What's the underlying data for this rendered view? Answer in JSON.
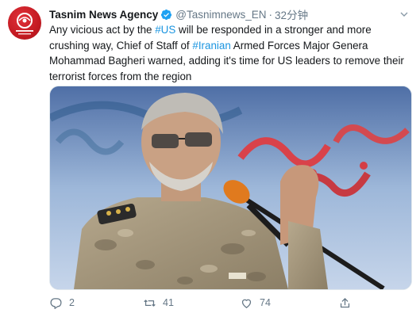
{
  "tweet": {
    "author_name": "Tasnim News Agency",
    "handle": "@Tasnimnews_EN",
    "separator": "·",
    "time": "32分钟",
    "verified": true,
    "text_parts": [
      {
        "text": "Any vicious act by the ",
        "type": "plain"
      },
      {
        "text": "#US",
        "type": "hashtag"
      },
      {
        "text": " will be responded in a stronger and more crushing way, Chief of Staff of ",
        "type": "plain"
      },
      {
        "text": "#Iranian",
        "type": "hashtag"
      },
      {
        "text": " Armed Forces Major Genera Mohammad Bagheri warned, adding it's time for US leaders to remove their terrorist forces from the region",
        "type": "plain"
      }
    ],
    "media_alt": "Military officer in camouflage uniform speaking into a microphone",
    "actions": {
      "reply_count": "2",
      "retweet_count": "41",
      "like_count": "74"
    }
  },
  "colors": {
    "link": "#1b95e0",
    "secondary_text": "#657786",
    "verified_badge": "#1da1f2",
    "avatar_bg": "#c41a22"
  },
  "icons": {
    "verified": "verified-badge-icon",
    "reply": "reply-icon",
    "retweet": "retweet-icon",
    "like": "heart-icon",
    "share": "share-icon",
    "menu": "chevron-down-icon"
  }
}
